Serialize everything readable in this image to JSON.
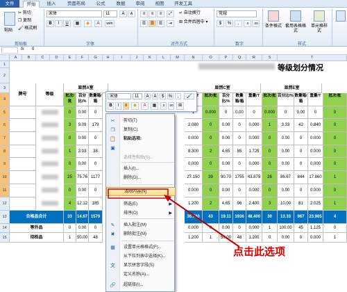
{
  "tabs": [
    "文件",
    "开始",
    "插入",
    "页面布局",
    "公式",
    "数据",
    "审阅",
    "视图",
    "开发工具"
  ],
  "ribbon": {
    "clipboard": {
      "paste": "粘贴",
      "cut": "剪切",
      "copy": "复制",
      "format_painter": "格式刷",
      "group": "剪贴板"
    },
    "font": {
      "name": "宋体",
      "size": "11",
      "group": "字体",
      "bold": "B",
      "italic": "I",
      "underline": "U",
      "grow": "A",
      "shrink": "A",
      "wen": "wén"
    },
    "align": {
      "wrap": "自动换行",
      "merge": "合并后居中",
      "group": "对齐方式"
    },
    "number": {
      "format": "常规",
      "percent": "%",
      "comma": ",",
      "group": "数字"
    },
    "styles": {
      "cond": "条件格式",
      "table": "套用表格格式",
      "cell": "单元格样式",
      "group": "样式"
    }
  },
  "formula_bar": {
    "name_box": "",
    "fx": "fx",
    "value": "0"
  },
  "columns": [
    "A",
    "B",
    "C",
    "D",
    "E",
    "F",
    "G",
    "H",
    "I",
    "J",
    "K",
    "L",
    "M",
    "N",
    "O",
    "P",
    "Q",
    "R",
    "S",
    "T"
  ],
  "rows": [
    "1",
    "2",
    "3",
    "4",
    "5",
    "6",
    "7",
    "8",
    "9",
    "10",
    "11",
    "12",
    "13",
    "14",
    "15"
  ],
  "sheet": {
    "title_right": "等级划分情况",
    "col_brand": "牌号",
    "col_grade": "等级",
    "grp_a": "显然A室",
    "grp_b": "显然B室",
    "grp_c": "显然C室",
    "grp_d": "显然E室",
    "sub": [
      "批次/批",
      "百分比/%",
      "数量箱/箱",
      "重量/T"
    ],
    "total_label": "合格品合计",
    "extra_label": "等外品",
    "reject_label": "待检品",
    "rows": [
      [
        "0",
        "0.00",
        "0",
        "0.000",
        "1",
        "0.000",
        "0",
        "0.00",
        "0",
        "0.000",
        "0",
        "0.00",
        "0",
        "0.000"
      ],
      [
        "3",
        "9.09",
        "179",
        "",
        "2.080",
        "0",
        "0.00",
        "0",
        "0.000",
        "1",
        "3.33",
        "42",
        "0.840"
      ],
      [
        "0",
        "0.00",
        "0",
        "",
        "0.000",
        "0",
        "0.00",
        "0",
        "0.000",
        "0",
        "0.00",
        "0",
        "0.000"
      ],
      [
        "1",
        "3.03",
        "38",
        "",
        "8.300",
        "2",
        "4.65",
        "85",
        "1.725",
        "0",
        "0.00",
        "0",
        "0.000"
      ],
      [
        "0",
        "0.00",
        "0",
        "",
        "0.000",
        "0",
        "0.00",
        "0",
        "0.000",
        "0",
        "0.00",
        "0",
        "0.000"
      ],
      [
        "25",
        "75.76",
        "1177",
        "",
        "27.150",
        "39",
        "90.70",
        "1755",
        "43.875",
        "26",
        "86.67",
        "844",
        "17.860"
      ],
      [
        "0",
        "0.00",
        "0",
        "",
        "0.000",
        "0",
        "0.00",
        "0",
        "0.000",
        "0",
        "0.00",
        "0",
        "0.000"
      ],
      [
        "4",
        "12.12",
        "185",
        "",
        "1.200",
        "2",
        "4.65",
        "96",
        "2.400",
        "3",
        "10.00",
        "81",
        "2.025"
      ]
    ],
    "total": [
      "33",
      "14.67",
      "1579",
      "",
      "36.730",
      "43",
      "19.11",
      "1936",
      "48.400",
      "30",
      "13.33",
      "967",
      "23.985"
    ],
    "extra": [
      "0",
      "0.00",
      "0",
      "",
      "0.000",
      "0",
      "0.00",
      "0",
      "0.000",
      "1",
      "100.00",
      "45",
      "1.125"
    ],
    "reject": [
      "1",
      "50.00",
      "48",
      "",
      "1.200",
      "1",
      "50.00",
      "48",
      "1.200",
      "0",
      "0.00",
      "0",
      "0.000"
    ],
    "right_col": [
      "0",
      "0",
      "0",
      "0",
      "0",
      "1",
      "0",
      "1",
      "4",
      "0",
      "1",
      "14"
    ]
  },
  "minibar": {
    "font": "宋体",
    "size": "11",
    "percent": "%",
    "comma": ","
  },
  "menu": [
    {
      "label": "剪切(T)",
      "icon": "scissors-icon",
      "glyph": "✂"
    },
    {
      "label": "复制(C)",
      "icon": "copy-icon",
      "glyph": "❐"
    },
    {
      "label": "粘贴选项:",
      "icon": "paste-icon",
      "glyph": "📋",
      "bold": true
    },
    {
      "label": "",
      "icon": "paste-option-icon",
      "glyph": "▣"
    },
    {
      "label": "选择性粘贴(S)...",
      "icon": "",
      "glyph": "",
      "disabled": true
    },
    {
      "label": "插入(I)...",
      "icon": "",
      "glyph": ""
    },
    {
      "label": "删除(D)...",
      "icon": "",
      "glyph": ""
    },
    {
      "label": "清除内容(N)",
      "icon": "",
      "glyph": "",
      "selected": true
    },
    {
      "label": "筛选(E)",
      "icon": "",
      "glyph": "",
      "submenu": true
    },
    {
      "label": "排序(O)",
      "icon": "",
      "glyph": "",
      "submenu": true
    },
    {
      "label": "插入批注(M)",
      "icon": "comment-icon",
      "glyph": "✎"
    },
    {
      "label": "删除批注(M)",
      "icon": "delete-comment-icon",
      "glyph": "✖"
    },
    {
      "label": "设置单元格格式(F)...",
      "icon": "format-cells-icon",
      "glyph": "▦"
    },
    {
      "label": "从下拉列表中选择(K)...",
      "icon": "",
      "glyph": ""
    },
    {
      "label": "显示拼音字段(S)",
      "icon": "pinyin-icon",
      "glyph": "文"
    },
    {
      "label": "定义名称(A)...",
      "icon": "",
      "glyph": ""
    },
    {
      "label": "超链接(I)...",
      "icon": "hyperlink-icon",
      "glyph": "🔗"
    }
  ],
  "callout": "点击此选项",
  "colors": {
    "accent": "#2a5ea8",
    "green": "#92d050",
    "highlight": "#0070c0",
    "arrow": "#c00000"
  }
}
